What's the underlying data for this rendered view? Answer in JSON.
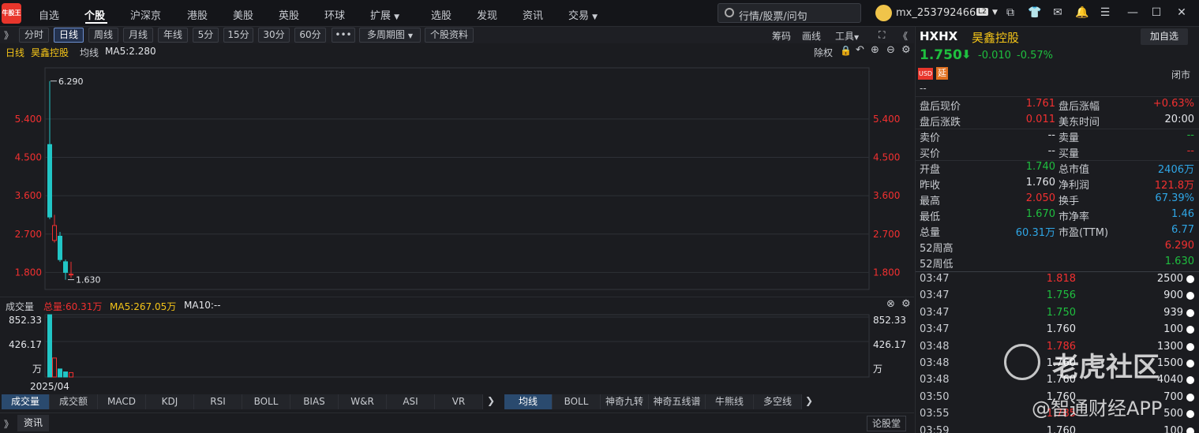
{
  "nav": {
    "logo": "牛股王",
    "items": [
      "自选",
      "个股",
      "沪深京",
      "港股",
      "美股",
      "英股",
      "环球",
      "扩展",
      "选股",
      "发现",
      "资讯",
      "交易"
    ],
    "active": "个股",
    "search_placeholder": "行情/股票/问句",
    "username": "mx_253792466",
    "user_badge": "L2"
  },
  "toolbar": {
    "periods": [
      "分时",
      "日线",
      "周线",
      "月线",
      "年线",
      "5分",
      "15分",
      "30分",
      "60分"
    ],
    "active_period": "日线",
    "more": "•••",
    "multi_period": "多周期图",
    "stock_info": "个股资料",
    "right_links": [
      "筹码",
      "画线",
      "工具"
    ]
  },
  "info_line": {
    "period_label": "日线",
    "stock_name": "昊鑫控股",
    "ma_label": "均线",
    "ma5": "MA5:2.280",
    "adjust": "除权"
  },
  "chart_data": {
    "type": "candlestick",
    "y_ticks": [
      "5.400",
      "4.500",
      "3.600",
      "2.700",
      "1.800"
    ],
    "ylim": [
      1.4,
      6.6
    ],
    "high_label": "6.290",
    "low_label": "1.630",
    "candles": [
      {
        "open": 3.1,
        "close": 4.8,
        "high": 6.29,
        "low": 3.05,
        "color": "up-cyan"
      },
      {
        "open": 2.55,
        "close": 2.9,
        "high": 3.15,
        "low": 2.5,
        "color": "red"
      },
      {
        "open": 2.65,
        "close": 2.1,
        "high": 2.75,
        "low": 2.05,
        "color": "down-cyan"
      },
      {
        "open": 2.05,
        "close": 1.8,
        "high": 2.1,
        "low": 1.63,
        "color": "down-cyan"
      },
      {
        "open": 1.74,
        "close": 1.76,
        "high": 2.05,
        "low": 1.67,
        "color": "red"
      }
    ],
    "volume": {
      "label": "成交量",
      "total": "总量:60.31万",
      "ma5": "MA5:267.05万",
      "ma10": "MA10:--",
      "y_ticks": [
        "852.33",
        "426.17",
        "万"
      ],
      "values": [
        852.33,
        260,
        110,
        70,
        60.31
      ],
      "vmax": 852.33
    },
    "x_label": "2025/04"
  },
  "indicator_tabs": [
    "成交量",
    "成交额",
    "MACD",
    "KDJ",
    "RSI",
    "BOLL",
    "BIAS",
    "W&R",
    "ASI",
    "VR"
  ],
  "overlay_tabs": [
    "均线",
    "BOLL",
    "神奇九转",
    "神奇五线谱",
    "牛熊线",
    "多空线"
  ],
  "bottom": {
    "news": "资讯",
    "forum": "论股堂"
  },
  "side": {
    "ticker": "HXHX",
    "name": "昊鑫控股",
    "add_watch": "加自选",
    "price": "1.750",
    "change": "-0.010",
    "change_pct": "-0.57%",
    "badge_usd": "USD",
    "badge_delay": "延",
    "market_status": "闭市",
    "dash": "--",
    "after_hours": [
      {
        "l1": "盘后现价",
        "v1": "1.761",
        "c1": "red",
        "l2": "盘后涨幅",
        "v2": "+0.63%",
        "c2": "red"
      },
      {
        "l1": "盘后涨跌",
        "v1": "0.011",
        "c1": "red",
        "l2": "美东时间",
        "v2": "20:00",
        "c2": "white"
      }
    ],
    "quote_book": [
      {
        "l1": "卖价",
        "v1": "--",
        "c1": "white",
        "l2": "卖量",
        "v2": "--",
        "c2": "green"
      },
      {
        "l1": "买价",
        "v1": "--",
        "c1": "white",
        "l2": "买量",
        "v2": "--",
        "c2": "red"
      }
    ],
    "stats": [
      {
        "l1": "开盘",
        "v1": "1.740",
        "c1": "green",
        "l2": "总市值",
        "v2": "2406万",
        "c2": "blue"
      },
      {
        "l1": "昨收",
        "v1": "1.760",
        "c1": "white",
        "l2": "净利润",
        "v2": "121.8万",
        "c2": "red"
      },
      {
        "l1": "最高",
        "v1": "2.050",
        "c1": "red",
        "l2": "换手",
        "v2": "67.39%",
        "c2": "blue"
      },
      {
        "l1": "最低",
        "v1": "1.670",
        "c1": "green",
        "l2": "市净率",
        "v2": "1.46",
        "c2": "blue"
      },
      {
        "l1": "总量",
        "v1": "60.31万",
        "c1": "blue",
        "l2": "市盈(TTM)",
        "v2": "6.77",
        "c2": "blue"
      }
    ],
    "week52": [
      {
        "l": "52周高",
        "v": "6.290",
        "c": "red"
      },
      {
        "l": "52周低",
        "v": "1.630",
        "c": "green"
      }
    ],
    "trades": [
      {
        "t": "03:47",
        "p": "1.818",
        "pc": "red",
        "v": "2500"
      },
      {
        "t": "03:47",
        "p": "1.756",
        "pc": "green",
        "v": "900"
      },
      {
        "t": "03:47",
        "p": "1.750",
        "pc": "green",
        "v": "939"
      },
      {
        "t": "03:47",
        "p": "1.760",
        "pc": "white",
        "v": "100"
      },
      {
        "t": "03:48",
        "p": "1.786",
        "pc": "red",
        "v": "1300"
      },
      {
        "t": "03:48",
        "p": "1.760",
        "pc": "white",
        "v": "1500"
      },
      {
        "t": "03:48",
        "p": "1.760",
        "pc": "white",
        "v": "4040"
      },
      {
        "t": "03:50",
        "p": "1.760",
        "pc": "white",
        "v": "700"
      },
      {
        "t": "03:55",
        "p": "1.785",
        "pc": "red",
        "v": "500"
      },
      {
        "t": "03:59",
        "p": "1.760",
        "pc": "white",
        "v": "100"
      }
    ]
  },
  "watermark": {
    "line1": "老虎社区",
    "line2": "@智通财经APP"
  }
}
